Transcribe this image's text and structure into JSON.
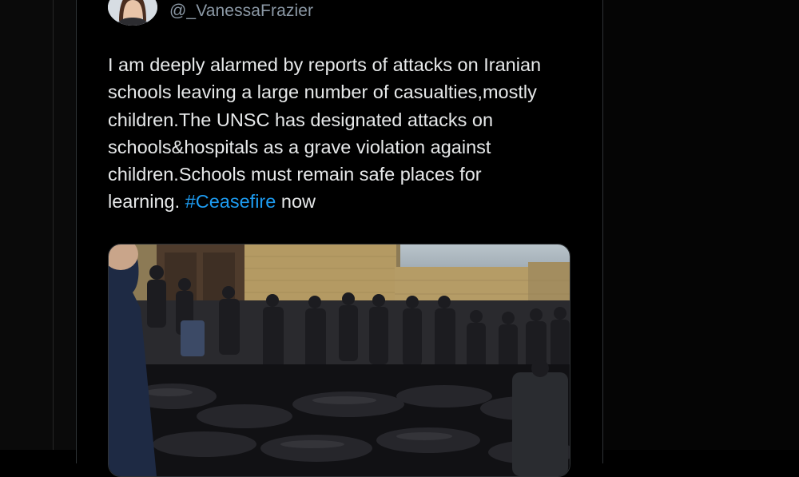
{
  "tweet": {
    "handle": "@_VanessaFrazier",
    "text_before_hashtag": "I am deeply alarmed by reports of attacks on Iranian\nschools leaving a large number of casualties,mostly\nchildren.The UNSC has designated attacks on\nschools&hospitals as a grave violation against\nchildren.Schools must remain safe places for\nlearning. ",
    "hashtag": "#Ceasefire",
    "text_after_hashtag": " now",
    "colors": {
      "background": "#000000",
      "text": "#e7e9ea",
      "muted": "#8b98a5",
      "link": "#1d9bf0"
    }
  },
  "icons": {
    "avatar": "profile-photo"
  }
}
